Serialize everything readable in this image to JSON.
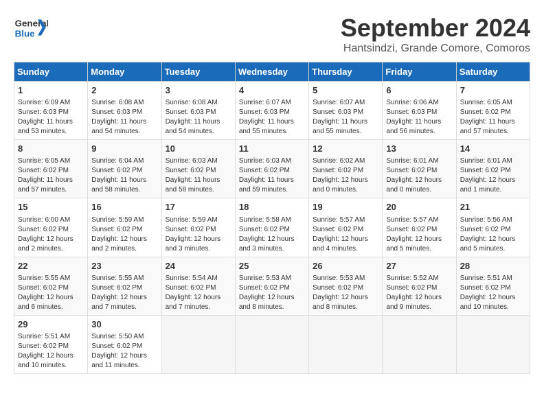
{
  "header": {
    "logo_general": "General",
    "logo_blue": "Blue",
    "month_title": "September 2024",
    "location": "Hantsindzi, Grande Comore, Comoros"
  },
  "days_of_week": [
    "Sunday",
    "Monday",
    "Tuesday",
    "Wednesday",
    "Thursday",
    "Friday",
    "Saturday"
  ],
  "weeks": [
    [
      {
        "day": "1",
        "sunrise": "6:09 AM",
        "sunset": "6:03 PM",
        "daylight": "11 hours and 53 minutes."
      },
      {
        "day": "2",
        "sunrise": "6:08 AM",
        "sunset": "6:03 PM",
        "daylight": "11 hours and 54 minutes."
      },
      {
        "day": "3",
        "sunrise": "6:08 AM",
        "sunset": "6:03 PM",
        "daylight": "11 hours and 54 minutes."
      },
      {
        "day": "4",
        "sunrise": "6:07 AM",
        "sunset": "6:03 PM",
        "daylight": "11 hours and 55 minutes."
      },
      {
        "day": "5",
        "sunrise": "6:07 AM",
        "sunset": "6:03 PM",
        "daylight": "11 hours and 55 minutes."
      },
      {
        "day": "6",
        "sunrise": "6:06 AM",
        "sunset": "6:03 PM",
        "daylight": "11 hours and 56 minutes."
      },
      {
        "day": "7",
        "sunrise": "6:05 AM",
        "sunset": "6:02 PM",
        "daylight": "11 hours and 57 minutes."
      }
    ],
    [
      {
        "day": "8",
        "sunrise": "6:05 AM",
        "sunset": "6:02 PM",
        "daylight": "11 hours and 57 minutes."
      },
      {
        "day": "9",
        "sunrise": "6:04 AM",
        "sunset": "6:02 PM",
        "daylight": "11 hours and 58 minutes."
      },
      {
        "day": "10",
        "sunrise": "6:03 AM",
        "sunset": "6:02 PM",
        "daylight": "11 hours and 58 minutes."
      },
      {
        "day": "11",
        "sunrise": "6:03 AM",
        "sunset": "6:02 PM",
        "daylight": "11 hours and 59 minutes."
      },
      {
        "day": "12",
        "sunrise": "6:02 AM",
        "sunset": "6:02 PM",
        "daylight": "12 hours and 0 minutes."
      },
      {
        "day": "13",
        "sunrise": "6:01 AM",
        "sunset": "6:02 PM",
        "daylight": "12 hours and 0 minutes."
      },
      {
        "day": "14",
        "sunrise": "6:01 AM",
        "sunset": "6:02 PM",
        "daylight": "12 hours and 1 minute."
      }
    ],
    [
      {
        "day": "15",
        "sunrise": "6:00 AM",
        "sunset": "6:02 PM",
        "daylight": "12 hours and 2 minutes."
      },
      {
        "day": "16",
        "sunrise": "5:59 AM",
        "sunset": "6:02 PM",
        "daylight": "12 hours and 2 minutes."
      },
      {
        "day": "17",
        "sunrise": "5:59 AM",
        "sunset": "6:02 PM",
        "daylight": "12 hours and 3 minutes."
      },
      {
        "day": "18",
        "sunrise": "5:58 AM",
        "sunset": "6:02 PM",
        "daylight": "12 hours and 3 minutes."
      },
      {
        "day": "19",
        "sunrise": "5:57 AM",
        "sunset": "6:02 PM",
        "daylight": "12 hours and 4 minutes."
      },
      {
        "day": "20",
        "sunrise": "5:57 AM",
        "sunset": "6:02 PM",
        "daylight": "12 hours and 5 minutes."
      },
      {
        "day": "21",
        "sunrise": "5:56 AM",
        "sunset": "6:02 PM",
        "daylight": "12 hours and 5 minutes."
      }
    ],
    [
      {
        "day": "22",
        "sunrise": "5:55 AM",
        "sunset": "6:02 PM",
        "daylight": "12 hours and 6 minutes."
      },
      {
        "day": "23",
        "sunrise": "5:55 AM",
        "sunset": "6:02 PM",
        "daylight": "12 hours and 7 minutes."
      },
      {
        "day": "24",
        "sunrise": "5:54 AM",
        "sunset": "6:02 PM",
        "daylight": "12 hours and 7 minutes."
      },
      {
        "day": "25",
        "sunrise": "5:53 AM",
        "sunset": "6:02 PM",
        "daylight": "12 hours and 8 minutes."
      },
      {
        "day": "26",
        "sunrise": "5:53 AM",
        "sunset": "6:02 PM",
        "daylight": "12 hours and 8 minutes."
      },
      {
        "day": "27",
        "sunrise": "5:52 AM",
        "sunset": "6:02 PM",
        "daylight": "12 hours and 9 minutes."
      },
      {
        "day": "28",
        "sunrise": "5:51 AM",
        "sunset": "6:02 PM",
        "daylight": "12 hours and 10 minutes."
      }
    ],
    [
      {
        "day": "29",
        "sunrise": "5:51 AM",
        "sunset": "6:02 PM",
        "daylight": "12 hours and 10 minutes."
      },
      {
        "day": "30",
        "sunrise": "5:50 AM",
        "sunset": "6:02 PM",
        "daylight": "12 hours and 11 minutes."
      },
      null,
      null,
      null,
      null,
      null
    ]
  ]
}
